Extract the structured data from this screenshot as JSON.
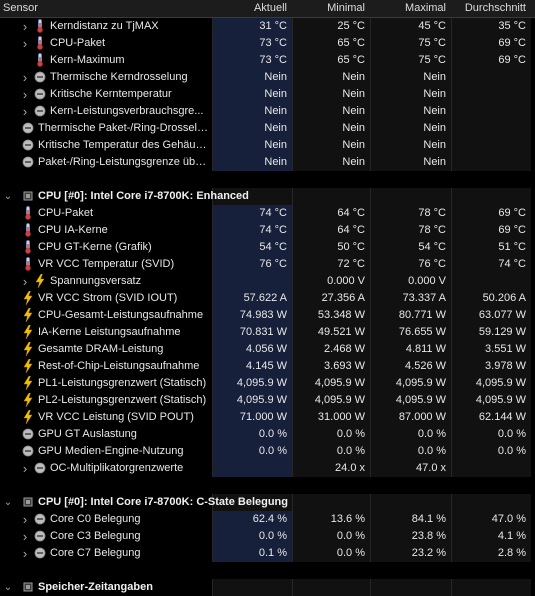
{
  "header": {
    "sensor": "Sensor",
    "aktuell": "Aktuell",
    "minimal": "Minimal",
    "maximal": "Maximal",
    "durchschnitt": "Durchschnitt"
  },
  "rows": [
    {
      "indent": 1,
      "chev": true,
      "icon": "thermometer",
      "label": "Kerndistanz zu TjMAX",
      "vals": [
        "31 °C",
        "25 °C",
        "45 °C",
        "35 °C"
      ]
    },
    {
      "indent": 1,
      "chev": true,
      "icon": "thermometer",
      "label": "CPU-Paket",
      "vals": [
        "73 °C",
        "65 °C",
        "75 °C",
        "69 °C"
      ]
    },
    {
      "indent": 1,
      "chev": false,
      "icon": "thermometer",
      "label": "Kern-Maximum",
      "vals": [
        "73 °C",
        "65 °C",
        "75 °C",
        "69 °C"
      ]
    },
    {
      "indent": 1,
      "chev": true,
      "icon": "circle",
      "label": "Thermische Kerndrosselung",
      "vals": [
        "Nein",
        "Nein",
        "Nein",
        ""
      ]
    },
    {
      "indent": 1,
      "chev": true,
      "icon": "circle",
      "label": "Kritische Kerntemperatur",
      "vals": [
        "Nein",
        "Nein",
        "Nein",
        ""
      ]
    },
    {
      "indent": 1,
      "chev": true,
      "icon": "circle",
      "label": "Kern-Leistungsverbrauchsgre...",
      "vals": [
        "Nein",
        "Nein",
        "Nein",
        ""
      ]
    },
    {
      "indent": 0,
      "chev": false,
      "icon": "circle",
      "label": "Thermische Paket-/Ring-Drosselung",
      "vals": [
        "Nein",
        "Nein",
        "Nein",
        ""
      ]
    },
    {
      "indent": 0,
      "chev": false,
      "icon": "circle",
      "label": "Kritische Temperatur des Gehäus...",
      "vals": [
        "Nein",
        "Nein",
        "Nein",
        ""
      ]
    },
    {
      "indent": 0,
      "chev": false,
      "icon": "circle",
      "label": "Paket-/Ring-Leistungsgrenze übe...",
      "vals": [
        "Nein",
        "Nein",
        "Nein",
        ""
      ]
    },
    {
      "type": "sep"
    },
    {
      "type": "section",
      "label": "CPU [#0]: Intel Core i7-8700K: Enhanced"
    },
    {
      "indent": 0,
      "chev": false,
      "icon": "thermometer",
      "label": "CPU-Paket",
      "vals": [
        "74 °C",
        "64 °C",
        "78 °C",
        "69 °C"
      ]
    },
    {
      "indent": 0,
      "chev": false,
      "icon": "thermometer",
      "label": "CPU IA-Kerne",
      "vals": [
        "74 °C",
        "64 °C",
        "78 °C",
        "69 °C"
      ]
    },
    {
      "indent": 0,
      "chev": false,
      "icon": "thermometer",
      "label": "CPU GT-Kerne (Grafik)",
      "vals": [
        "54 °C",
        "50 °C",
        "54 °C",
        "51 °C"
      ]
    },
    {
      "indent": 0,
      "chev": false,
      "icon": "thermometer",
      "label": "VR VCC Temperatur (SVID)",
      "vals": [
        "76 °C",
        "72 °C",
        "76 °C",
        "74 °C"
      ]
    },
    {
      "indent": 1,
      "chev": true,
      "icon": "bolt",
      "label": "Spannungsversatz",
      "vals": [
        "",
        "0.000 V",
        "0.000 V",
        ""
      ]
    },
    {
      "indent": 0,
      "chev": false,
      "icon": "bolt",
      "label": "VR VCC Strom (SVID IOUT)",
      "vals": [
        "57.622 A",
        "27.356 A",
        "73.337 A",
        "50.206 A"
      ]
    },
    {
      "indent": 0,
      "chev": false,
      "icon": "bolt",
      "label": "CPU-Gesamt-Leistungsaufnahme",
      "vals": [
        "74.983 W",
        "53.348 W",
        "80.771 W",
        "63.077 W"
      ]
    },
    {
      "indent": 0,
      "chev": false,
      "icon": "bolt",
      "label": "IA-Kerne Leistungsaufnahme",
      "vals": [
        "70.831 W",
        "49.521 W",
        "76.655 W",
        "59.129 W"
      ]
    },
    {
      "indent": 0,
      "chev": false,
      "icon": "bolt",
      "label": "Gesamte DRAM-Leistung",
      "vals": [
        "4.056 W",
        "2.468 W",
        "4.811 W",
        "3.551 W"
      ]
    },
    {
      "indent": 0,
      "chev": false,
      "icon": "bolt",
      "label": "Rest-of-Chip-Leistungsaufnahme",
      "vals": [
        "4.145 W",
        "3.693 W",
        "4.526 W",
        "3.978 W"
      ]
    },
    {
      "indent": 0,
      "chev": false,
      "icon": "bolt",
      "label": "PL1-Leistungsgrenzwert (Statisch)",
      "vals": [
        "4,095.9 W",
        "4,095.9 W",
        "4,095.9 W",
        "4,095.9 W"
      ]
    },
    {
      "indent": 0,
      "chev": false,
      "icon": "bolt",
      "label": "PL2-Leistungsgrenzwert (Statisch)",
      "vals": [
        "4,095.9 W",
        "4,095.9 W",
        "4,095.9 W",
        "4,095.9 W"
      ]
    },
    {
      "indent": 0,
      "chev": false,
      "icon": "bolt",
      "label": "VR VCC Leistung (SVID POUT)",
      "vals": [
        "71.000 W",
        "31.000 W",
        "87.000 W",
        "62.144 W"
      ]
    },
    {
      "indent": 0,
      "chev": false,
      "icon": "circle",
      "label": "GPU GT Auslastung",
      "vals": [
        "0.0 %",
        "0.0 %",
        "0.0 %",
        "0.0 %"
      ]
    },
    {
      "indent": 0,
      "chev": false,
      "icon": "circle",
      "label": "GPU Medien-Engine-Nutzung",
      "vals": [
        "0.0 %",
        "0.0 %",
        "0.0 %",
        "0.0 %"
      ]
    },
    {
      "indent": 1,
      "chev": true,
      "icon": "circle",
      "label": "OC-Multiplikatorgrenzwerte",
      "vals": [
        "",
        "24.0 x",
        "47.0 x",
        ""
      ]
    },
    {
      "type": "sep"
    },
    {
      "type": "section",
      "label": "CPU [#0]: Intel Core i7-8700K: C-State Belegung"
    },
    {
      "indent": 1,
      "chev": true,
      "icon": "circle",
      "label": "Core C0 Belegung",
      "vals": [
        "62.4 %",
        "13.6 %",
        "84.1 %",
        "47.0 %"
      ]
    },
    {
      "indent": 1,
      "chev": true,
      "icon": "circle",
      "label": "Core C3 Belegung",
      "vals": [
        "0.0 %",
        "0.0 %",
        "23.8 %",
        "4.1 %"
      ]
    },
    {
      "indent": 1,
      "chev": true,
      "icon": "circle",
      "label": "Core C7 Belegung",
      "vals": [
        "0.1 %",
        "0.0 %",
        "23.2 %",
        "2.8 %"
      ]
    },
    {
      "type": "sep"
    },
    {
      "type": "section",
      "label": "Speicher-Zeitangaben"
    }
  ]
}
